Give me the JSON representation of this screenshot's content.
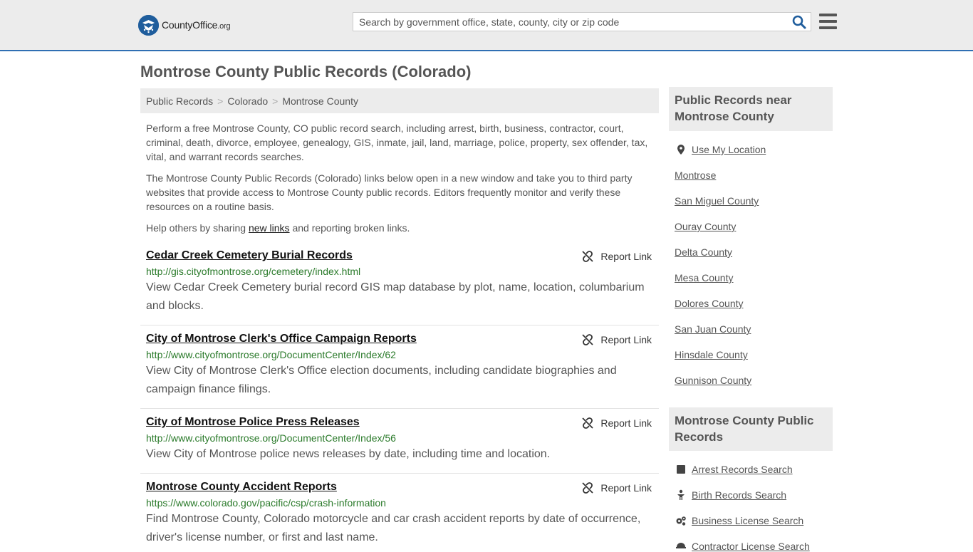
{
  "header": {
    "logo_brand": "CountyOffice",
    "logo_tld": ".org",
    "search_placeholder": "Search by government office, state, county, city or zip code"
  },
  "page_title": "Montrose County Public Records (Colorado)",
  "breadcrumb": [
    "Public Records",
    "Colorado",
    "Montrose County"
  ],
  "intro": {
    "p1": "Perform a free Montrose County, CO public record search, including arrest, birth, business, contractor, court, criminal, death, divorce, employee, genealogy, GIS, inmate, jail, land, marriage, police, property, sex offender, tax, vital, and warrant records searches.",
    "p2": "The Montrose County Public Records (Colorado) links below open in a new window and take you to third party websites that provide access to Montrose County public records. Editors frequently monitor and verify these resources on a routine basis.",
    "p3_before": "Help others by sharing ",
    "p3_link": "new links",
    "p3_after": " and reporting broken links."
  },
  "report_label": "Report Link",
  "records": [
    {
      "title": "Cedar Creek Cemetery Burial Records",
      "url": "http://gis.cityofmontrose.org/cemetery/index.html",
      "desc": "View Cedar Creek Cemetery burial record GIS map database by plot, name, location, columbarium and blocks."
    },
    {
      "title": "City of Montrose Clerk's Office Campaign Reports",
      "url": "http://www.cityofmontrose.org/DocumentCenter/Index/62",
      "desc": "View City of Montrose Clerk's Office election documents, including candidate biographies and campaign finance filings."
    },
    {
      "title": "City of Montrose Police Press Releases",
      "url": "http://www.cityofmontrose.org/DocumentCenter/Index/56",
      "desc": "View City of Montrose police news releases by date, including time and location."
    },
    {
      "title": "Montrose County Accident Reports",
      "url": "https://www.colorado.gov/pacific/csp/crash-information",
      "desc": "Find Montrose County, Colorado motorcycle and car crash accident reports by date of occurrence, driver's license number, or first and last name."
    }
  ],
  "sidebar": {
    "near_title": "Public Records near Montrose County",
    "use_location": "Use My Location",
    "near_links": [
      "Montrose",
      "San Miguel County",
      "Ouray County",
      "Delta County",
      "Mesa County",
      "Dolores County",
      "San Juan County",
      "Hinsdale County",
      "Gunnison County"
    ],
    "records_title": "Montrose County Public Records",
    "record_links": [
      {
        "label": "Arrest Records Search",
        "icon": "arrest-icon"
      },
      {
        "label": "Birth Records Search",
        "icon": "baby-icon"
      },
      {
        "label": "Business License Search",
        "icon": "gears-icon"
      },
      {
        "label": "Contractor License Search",
        "icon": "contractor-icon"
      }
    ]
  }
}
